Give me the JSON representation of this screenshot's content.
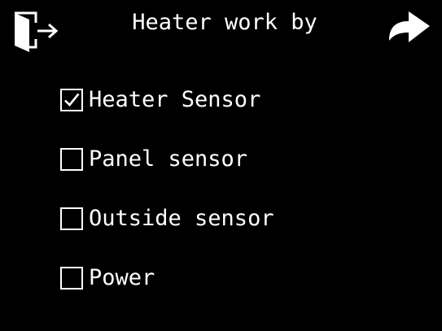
{
  "header": {
    "title": "Heater work by",
    "exit_icon": "exit-door-icon",
    "next_icon": "forward-arrow-icon"
  },
  "options": [
    {
      "label": "Heater Sensor",
      "checked": true
    },
    {
      "label": "Panel sensor",
      "checked": false
    },
    {
      "label": "Outside sensor",
      "checked": false
    },
    {
      "label": "Power",
      "checked": false
    }
  ],
  "colors": {
    "background": "#000000",
    "foreground": "#ffffff"
  }
}
